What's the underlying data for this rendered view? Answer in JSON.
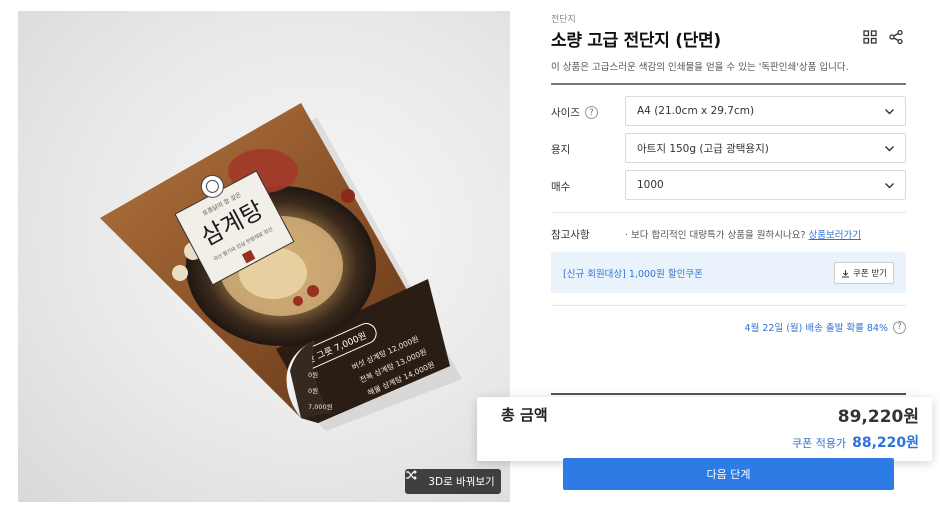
{
  "product_image": {
    "view_3d_label": "3D로 바꿔보기",
    "poster": {
      "small_caption": "토종닭의 참 깊은",
      "main_title": "삼계탕",
      "sub_caption": "국산 황기와 인삼 한방재료 엄선",
      "price_badge": "한 그릇 7,000원",
      "menu": [
        "버섯 삼계탕 12,000원",
        "전복 삼계탕 13,000원",
        "해물 삼계탕 14,000원"
      ],
      "fold_menu": [
        "0원",
        "0원",
        "7,000원"
      ]
    }
  },
  "product": {
    "category": "전단지",
    "title": "소량 고급 전단지 (단면)",
    "description": "이 상품은 고급스러운 색감의 인쇄물을 얻을 수 있는 '독판인쇄'상품 입니다.",
    "icons": [
      "grid-icon",
      "share-icon"
    ]
  },
  "options": [
    {
      "label": "사이즈",
      "value": "A4 (21.0cm x 29.7cm)",
      "has_help": true
    },
    {
      "label": "용지",
      "value": "아트지 150g (고급 광택용지)",
      "has_help": false
    },
    {
      "label": "매수",
      "value": "1000",
      "has_help": false
    }
  ],
  "reference": {
    "label": "참고사항",
    "text": "· 보다 합리적인 대량특가 상품을 원하시나요?",
    "link": "상품보러가기"
  },
  "coupon": {
    "text": "[신규 회원대상] 1,000원 할인쿠폰",
    "button": "쿠폰 받기"
  },
  "delivery": {
    "text": "4월 22일 (월) 배송 출발 확률 84%"
  },
  "total": {
    "label": "총 금액",
    "price": "89,220원",
    "coupon_label": "쿠폰 적용가",
    "coupon_price": "88,220원"
  },
  "next_button": "다음 단계",
  "colors": {
    "accent": "#2d7ce6",
    "link": "#2f73d8",
    "coupon_bg": "#eaf3fc"
  }
}
